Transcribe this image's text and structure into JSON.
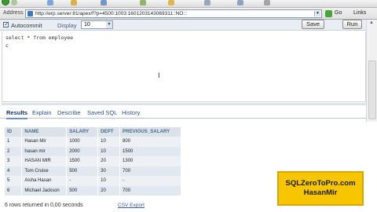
{
  "browser": {
    "address_label": "Address",
    "url": "http://erp.server:81/apex/f?p=4500:1003:1601203143069311::NO:::",
    "go_label": "Go",
    "links_label": "Links"
  },
  "sql_toolbar": {
    "autocommit_label": "Autocommit",
    "autocommit_checked": true,
    "display_label": "Display",
    "display_value": "10",
    "save_label": "Save",
    "run_label": "Run"
  },
  "editor": {
    "sql_text": "select * from employee",
    "cursor_line": "c"
  },
  "tabs": [
    {
      "label": "Results",
      "active": true
    },
    {
      "label": "Explain",
      "active": false
    },
    {
      "label": "Describe",
      "active": false
    },
    {
      "label": "Saved SQL",
      "active": false
    },
    {
      "label": "History",
      "active": false
    }
  ],
  "results": {
    "columns": [
      "ID",
      "NAME",
      "SALARY",
      "DEPT",
      "PREVIOUS_SALARY"
    ],
    "rows": [
      [
        "1",
        "Hasan Mir",
        "1000",
        "10",
        "800"
      ],
      [
        "2",
        "hasan mir",
        "2000",
        "10",
        "1500"
      ],
      [
        "3",
        "HASAN MIR",
        "1500",
        "20",
        "1300"
      ],
      [
        "4",
        "Tom Cruise",
        "500",
        "30",
        "700"
      ],
      [
        "5",
        "Aisha Hasan",
        "-",
        "10",
        "-"
      ],
      [
        "6",
        "Michael Jackson",
        "500",
        "20",
        "700"
      ]
    ],
    "row_count_text": "6 rows returned in 0,00 seconds",
    "csv_export_label": "CSV Export"
  },
  "watermark": {
    "line1": "SQLZeroToPro.com",
    "line2": "HasanMir",
    "color": "#f8c600"
  }
}
